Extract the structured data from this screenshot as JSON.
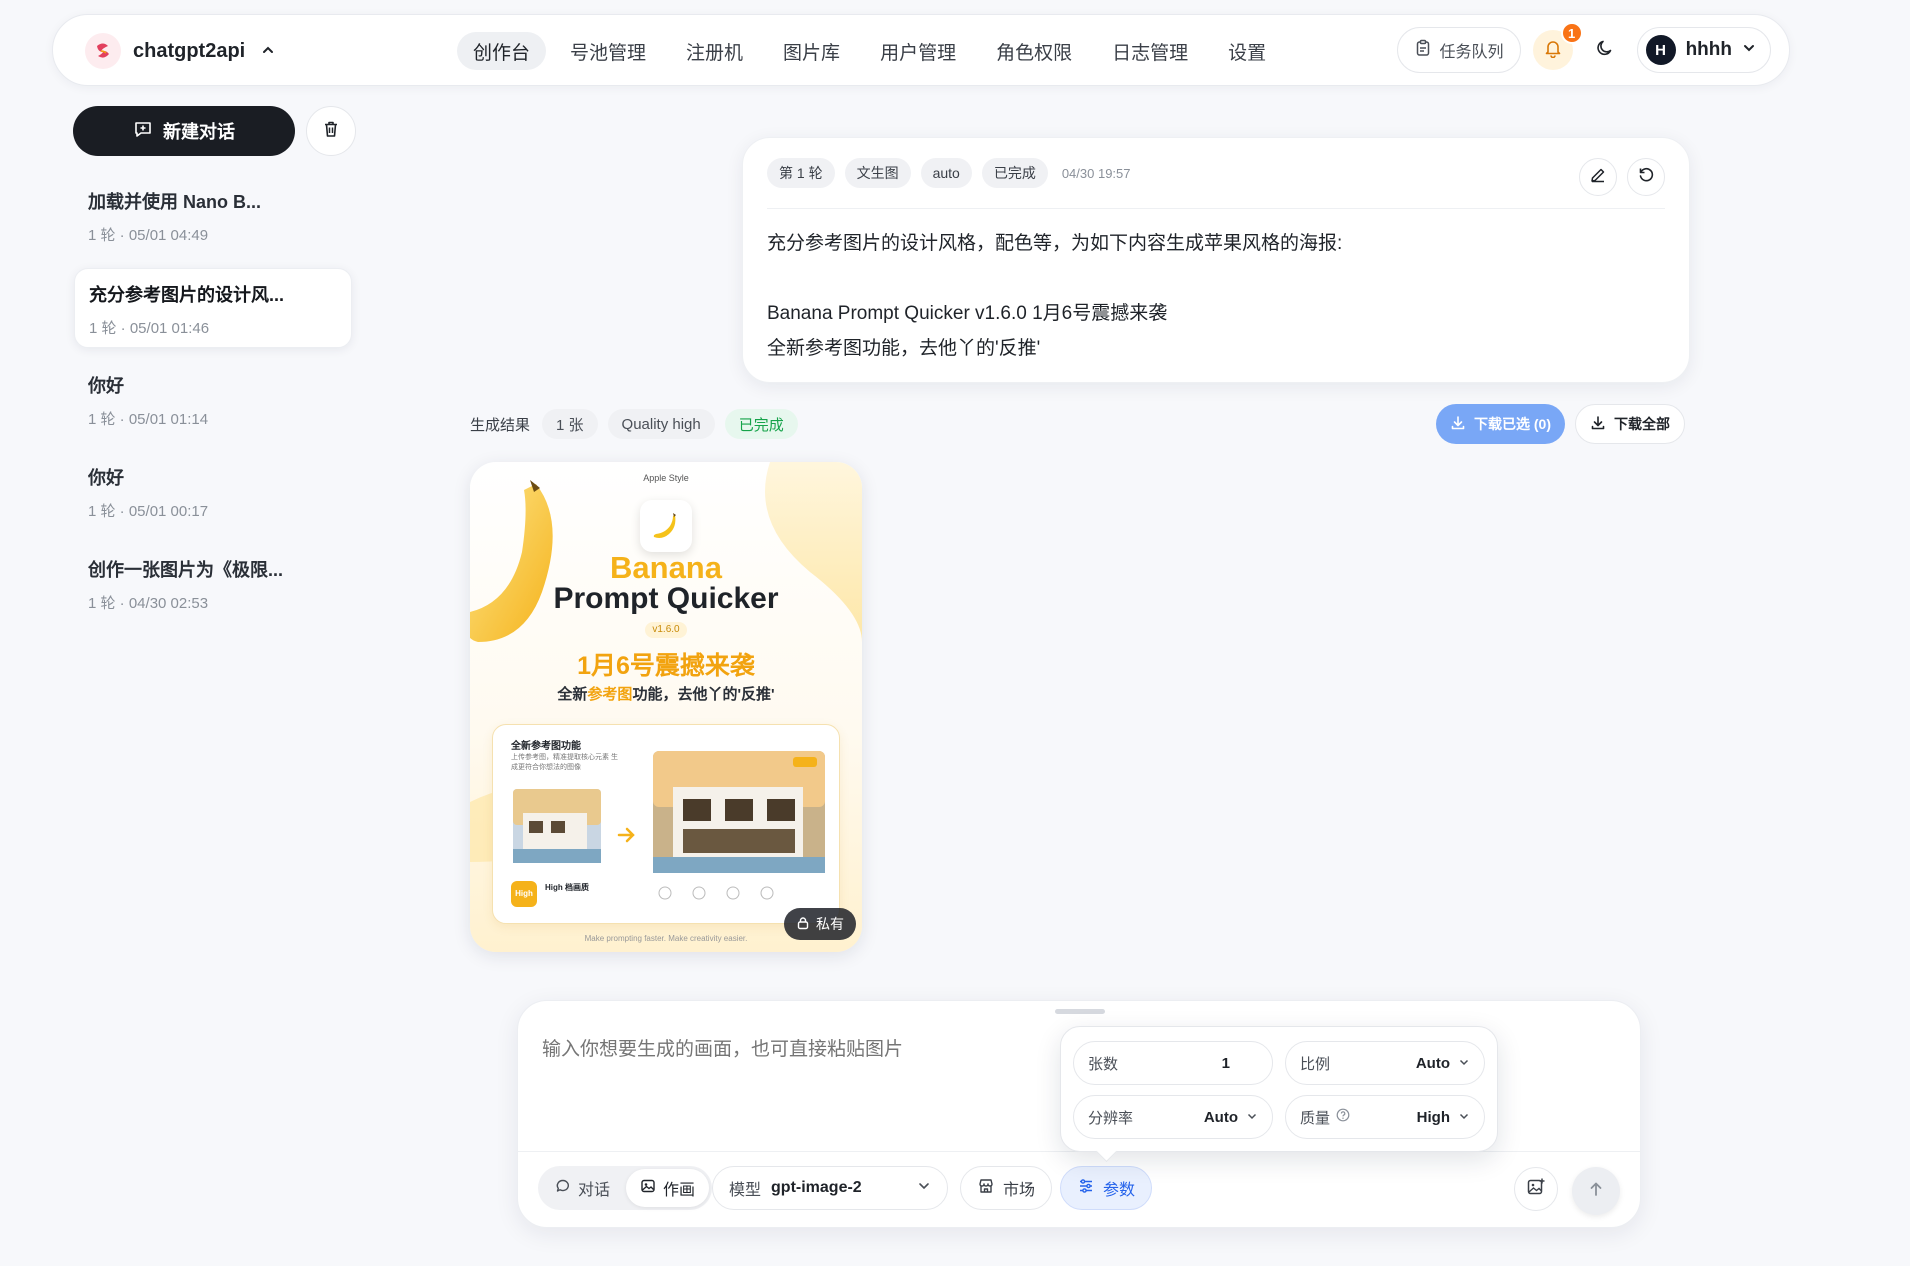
{
  "app": {
    "name": "chatgpt2api"
  },
  "nav": {
    "items": [
      {
        "label": "创作台",
        "active": true
      },
      {
        "label": "号池管理"
      },
      {
        "label": "注册机"
      },
      {
        "label": "图片库"
      },
      {
        "label": "用户管理"
      },
      {
        "label": "角色权限"
      },
      {
        "label": "日志管理"
      },
      {
        "label": "设置"
      }
    ],
    "queue_label": "任务队列",
    "notification_count": "1",
    "user_initial": "H",
    "user_name": "hhhh"
  },
  "sidebar": {
    "new_chat_label": "新建对话",
    "conversations": [
      {
        "title": "加载并使用 Nano B...",
        "meta": "1 轮 · 05/01 04:49"
      },
      {
        "title": "充分参考图片的设计风...",
        "meta": "1 轮 · 05/01 01:46",
        "active": true
      },
      {
        "title": "你好",
        "meta": "1 轮 · 05/01 01:14"
      },
      {
        "title": "你好",
        "meta": "1 轮 · 05/01 00:17"
      },
      {
        "title": "创作一张图片为《极限...",
        "meta": "1 轮 · 04/30 02:53"
      }
    ]
  },
  "prompt_card": {
    "tags": [
      "第 1 轮",
      "文生图",
      "auto",
      "已完成"
    ],
    "time": "04/30 19:57",
    "lines": [
      "充分参考图片的设计风格，配色等，为如下内容生成苹果风格的海报:",
      "",
      "Banana Prompt Quicker v1.6.0 1月6号震撼来袭",
      "全新参考图功能，去他丫的'反推'"
    ]
  },
  "result": {
    "label": "生成结果",
    "count": "1 张",
    "quality": "Quality high",
    "status": "已完成",
    "download_selected": "下载已选 (0)",
    "download_all": "下载全部"
  },
  "poster": {
    "apple_style": "Apple Style",
    "title_1": "Banana",
    "title_2": "Prompt Quicker",
    "version": "v1.6.0",
    "date_line": "1月6号震撼来袭",
    "sub_pre": "全新",
    "sub_accent": "参考图",
    "sub_post": "功能，去他丫的'反推'",
    "panel_title": "全新参考图功能",
    "panel_desc": "上传参考图，精准提取核心元素 生成更符合你想法的图像",
    "high_tag": "High",
    "high_label": "High 档画质",
    "footer": "Make prompting faster.   Make creativity easier.",
    "private_label": "私有"
  },
  "composer": {
    "placeholder": "输入你想要生成的画面，也可直接粘贴图片",
    "mode_chat": "对话",
    "mode_draw": "作画",
    "model_label": "模型",
    "model_value": "gpt-image-2",
    "market_label": "市场",
    "params_label": "参数"
  },
  "params": {
    "count_label": "张数",
    "count_value": "1",
    "ratio_label": "比例",
    "ratio_value": "Auto",
    "resolution_label": "分辨率",
    "resolution_value": "Auto",
    "quality_label": "质量",
    "quality_value": "High"
  },
  "colors": {
    "primary_dark": "#1a1d23",
    "accent_blue": "#2563eb",
    "success_green": "#16a34a",
    "banana_yellow": "#f5b21a",
    "notify_orange": "#f97316"
  }
}
